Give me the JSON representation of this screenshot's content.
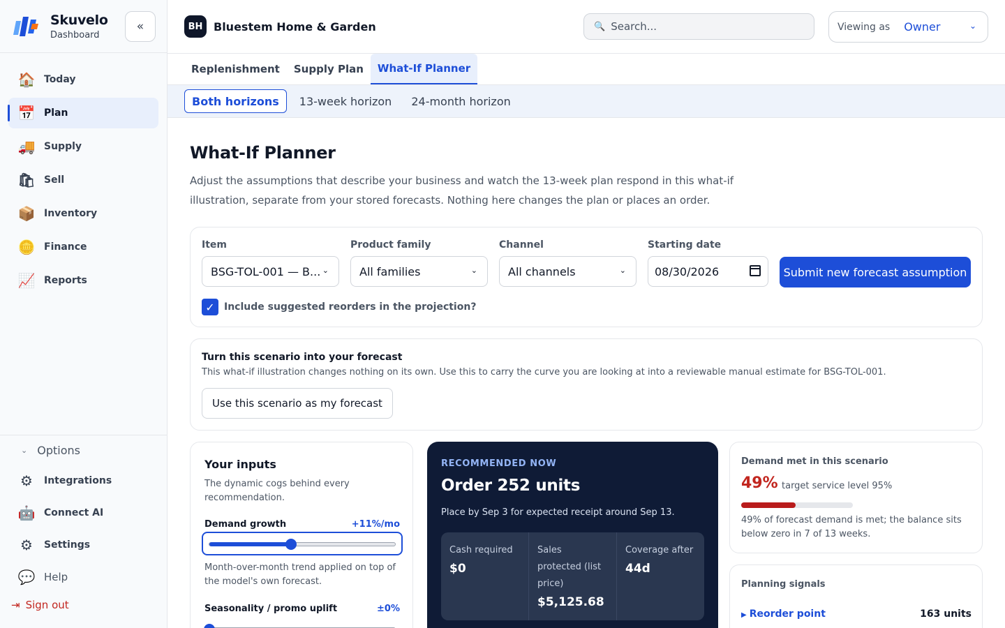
{
  "brand": {
    "name": "Skuvelo",
    "subtitle": "Dashboard"
  },
  "sidebar": {
    "items": [
      {
        "label": "Today",
        "icon": "house-icon"
      },
      {
        "label": "Plan",
        "icon": "calendar-icon",
        "active": true
      },
      {
        "label": "Supply",
        "icon": "truck-icon"
      },
      {
        "label": "Sell",
        "icon": "shopping-bag-icon"
      },
      {
        "label": "Inventory",
        "icon": "box-icon"
      },
      {
        "label": "Finance",
        "icon": "coin-icon"
      },
      {
        "label": "Reports",
        "icon": "chart-icon"
      }
    ],
    "options_label": "Options",
    "options_items": [
      {
        "label": "Integrations",
        "icon": "gears-icon"
      },
      {
        "label": "Connect AI",
        "icon": "robot-icon"
      },
      {
        "label": "Settings",
        "icon": "gear-icon"
      },
      {
        "label": "Help",
        "icon": "chat-bubble-icon"
      }
    ],
    "sign_out": "Sign out"
  },
  "header": {
    "org_initials": "BH",
    "org_name": "Bluestem Home & Garden",
    "search_placeholder": "Search...",
    "viewing_label": "Viewing as",
    "viewing_value": "Owner"
  },
  "tabs": [
    "Replenishment",
    "Supply Plan",
    "What-If Planner"
  ],
  "horizons": [
    "Both horizons",
    "13-week horizon",
    "24-month horizon"
  ],
  "page": {
    "title": "What-If Planner",
    "description": "Adjust the assumptions that describe your business and watch the 13-week plan respond in this what-if illustration, separate from your stored forecasts. Nothing here changes the plan or places an order."
  },
  "filters": {
    "item_label": "Item",
    "item_value": "BSG-TOL-001 — B...",
    "family_label": "Product family",
    "family_value": "All families",
    "channel_label": "Channel",
    "channel_value": "All channels",
    "date_label": "Starting date",
    "date_value": "08/30/2026",
    "submit_label": "Submit new forecast assumption",
    "include_reorders_label": "Include suggested reorders in the projection?",
    "include_reorders": true
  },
  "scenario": {
    "title": "Turn this scenario into your forecast",
    "text": "This what-if illustration changes nothing on its own. Use this to carry the curve you are looking at into a reviewable manual estimate for BSG-TOL-001.",
    "button": "Use this scenario as my forecast"
  },
  "inputs": {
    "title": "Your inputs",
    "subtitle": "The dynamic cogs behind every recommendation.",
    "demand_growth_label": "Demand growth",
    "demand_growth_value": "+11%/mo",
    "demand_growth_level": 0.44,
    "demand_growth_help": "Month-over-month trend applied on top of the model's own forecast.",
    "seasonality_label": "Seasonality / promo uplift",
    "seasonality_value": "±0%",
    "seasonality_level": 0.0
  },
  "recommendation": {
    "eyebrow": "RECOMMENDED NOW",
    "headline": "Order 252 units",
    "detail": "Place by Sep 3 for expected receipt around Sep 13.",
    "metrics": [
      {
        "label": "Cash required",
        "value": "$0"
      },
      {
        "label": "Sales protected (list price)",
        "value": "$5,125.68"
      },
      {
        "label": "Coverage after",
        "value": "44d"
      }
    ]
  },
  "demand_met": {
    "title": "Demand met in this scenario",
    "percent": "49%",
    "percent_value": 0.49,
    "target": "target service level 95%",
    "note": "49% of forecast demand is met; the balance sits below zero in 7 of 13 weeks."
  },
  "signals": {
    "title": "Planning signals",
    "rows": [
      {
        "label": "Reorder point",
        "value": "163 units"
      }
    ]
  },
  "colors": {
    "accent": "#1d4ed8",
    "danger": "#c2261f",
    "dark_card": "#0f1b36"
  }
}
